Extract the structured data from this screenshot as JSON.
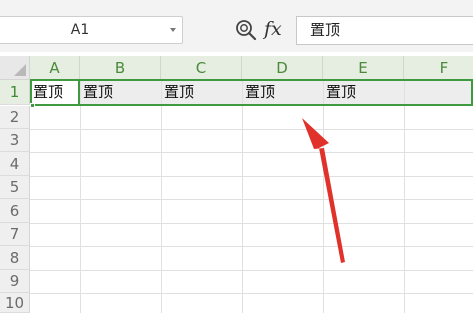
{
  "formula_bar": {
    "name_box": "A1",
    "zoom_icon": "magnifier-zoom-icon",
    "fx_label": "fx",
    "formula_value": "置顶"
  },
  "columns": [
    "A",
    "B",
    "C",
    "D",
    "E",
    "F"
  ],
  "rows": [
    "1",
    "2",
    "3",
    "4",
    "5",
    "6",
    "7",
    "8",
    "9",
    "10"
  ],
  "cells": {
    "A1": "置顶",
    "B1": "置顶",
    "C1": "置顶",
    "D1": "置顶",
    "E1": "置顶"
  },
  "selection": {
    "active_cell": "A1",
    "selected_row": "1"
  },
  "annotation": {
    "arrow_icon": "red-arrow-icon",
    "arrow_color": "#e0322a"
  },
  "colors": {
    "selection": "#3f9a3f",
    "header_active_text": "#4a8a3a"
  }
}
